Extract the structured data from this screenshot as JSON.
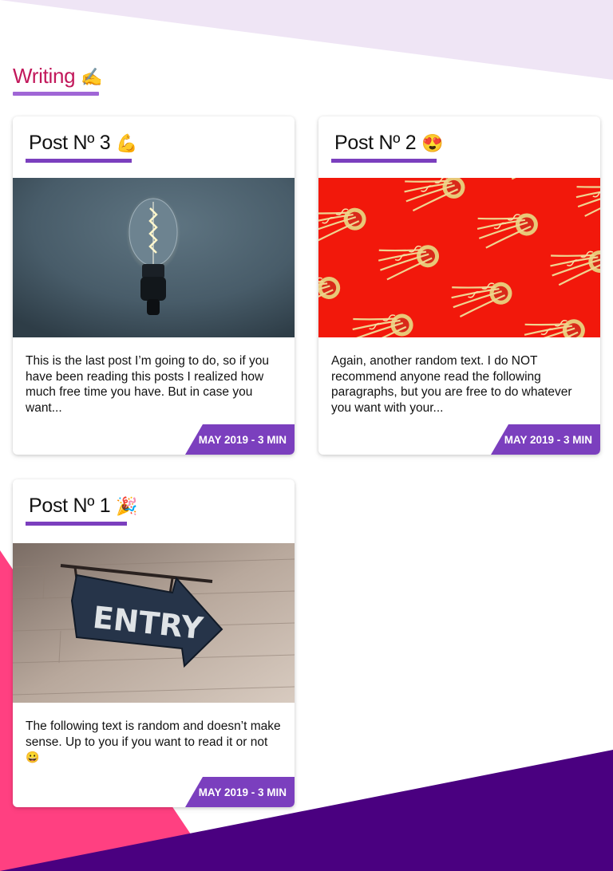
{
  "section": {
    "title": "Writing",
    "title_emoji": "✍️"
  },
  "posts": [
    {
      "title": "Post Nº 3",
      "emoji": "💪",
      "image": "light-bulb-photo",
      "excerpt": "This is the last post I’m going to do, so if you have been reading this posts I realized how much free time you have. But in case you want...",
      "meta": "MAY 2019 - 3 MIN"
    },
    {
      "title": "Post Nº 2",
      "emoji": "😍",
      "image": "noodles-pattern-photo",
      "excerpt": "Again, another random text. I do NOT recommend anyone read the following paragraphs, but you are free to do whatever you want with your...",
      "meta": "MAY 2019 - 3 MIN"
    },
    {
      "title": "Post Nº 1",
      "emoji": "🎉",
      "image": "entry-sign-photo",
      "excerpt": "The following text is random and doesn’t make sense. Up to you if you want to read it or not",
      "excerpt_emoji": "😀",
      "meta": "MAY 2019 - 3 MIN"
    }
  ],
  "colors": {
    "section_title": "#c2185b",
    "accent_purple": "#7b3fbe",
    "bg_top_lavender": "#efe5f5",
    "bg_bottom_pink": "#ff4081",
    "bg_bottom_purple": "#4a0080"
  }
}
